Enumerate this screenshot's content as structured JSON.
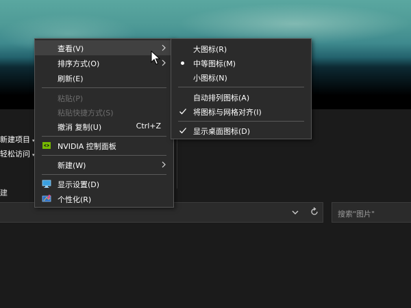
{
  "explorer": {
    "ribbon": [
      {
        "label": "新建项目",
        "caret": "▾"
      },
      {
        "label": "轻松访问",
        "caret": "▾"
      }
    ],
    "section_label": "建",
    "search_placeholder": "搜索\"图片\""
  },
  "context_menu": {
    "items": [
      {
        "label": "查看(V)",
        "submenu": true,
        "highlighted": true
      },
      {
        "label": "排序方式(O)",
        "submenu": true
      },
      {
        "label": "刷新(E)"
      },
      {
        "label": "粘贴(P)",
        "disabled": true
      },
      {
        "label": "粘贴快捷方式(S)",
        "disabled": true
      },
      {
        "label": "撤消 复制(U)",
        "shortcut": "Ctrl+Z"
      },
      {
        "label": "NVIDIA 控制面板",
        "icon": "nvidia-icon"
      },
      {
        "label": "新建(W)",
        "submenu": true
      },
      {
        "label": "显示设置(D)",
        "icon": "display-settings-icon"
      },
      {
        "label": "个性化(R)",
        "icon": "personalize-icon"
      }
    ]
  },
  "view_submenu": {
    "items": [
      {
        "label": "大图标(R)"
      },
      {
        "label": "中等图标(M)",
        "selected": true
      },
      {
        "label": "小图标(N)"
      },
      {
        "label": "自动排列图标(A)"
      },
      {
        "label": "将图标与网格对齐(I)",
        "checked": true
      },
      {
        "label": "显示桌面图标(D)",
        "checked": true
      }
    ]
  },
  "colors": {
    "menu_bg": "#2b2b2b",
    "menu_highlight": "#414141",
    "disabled_text": "#6e6e6e",
    "nvidia_green": "#76b900",
    "display_blue": "#3aa0e0"
  }
}
